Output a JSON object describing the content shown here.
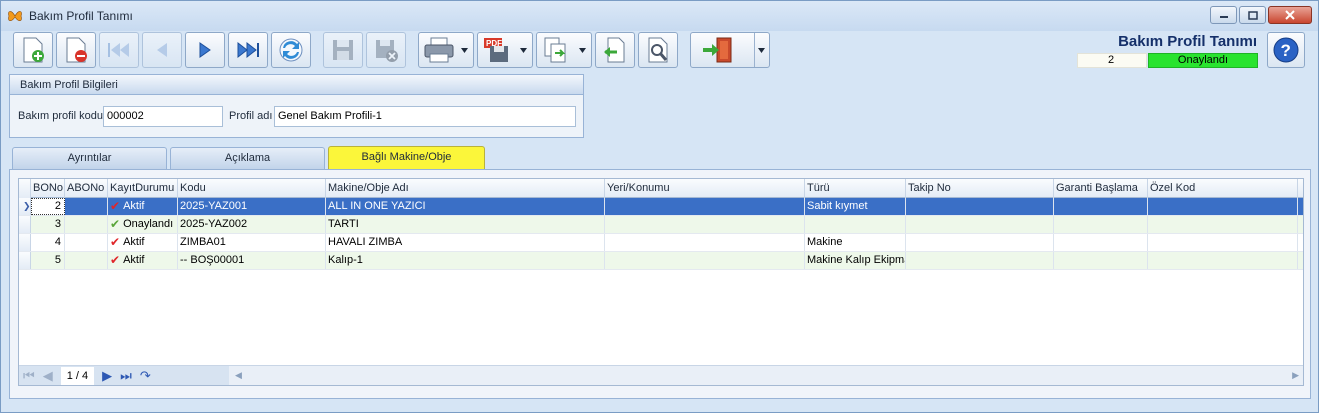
{
  "window": {
    "title": "Bakım Profil Tanımı"
  },
  "toolbar": {
    "buttons": [
      "new-icon",
      "delete-icon",
      "first-icon",
      "prev-icon",
      "next-icon",
      "last-icon",
      "refresh-icon",
      "save-icon",
      "cancel-save-icon",
      "print-icon",
      "pdf-export-icon",
      "export-icon",
      "import-icon",
      "settings-icon",
      "exit-icon"
    ]
  },
  "header": {
    "title": "Bakım Profil Tanımı",
    "record_no": "2",
    "status": "Onaylandı",
    "status_color": "#29e32f"
  },
  "profile_group": {
    "title": "Bakım Profil Bilgileri",
    "code_label": "Bakım profil kodu",
    "code_value": "000002",
    "name_label": "Profil adı",
    "name_value": "Genel Bakım Profili-1"
  },
  "tabs": [
    {
      "label": "Ayrıntılar"
    },
    {
      "label": "Açıklama"
    },
    {
      "label": "Bağlı Makine/Obje",
      "active": true
    }
  ],
  "grid": {
    "columns": [
      "BONo",
      "ABONo",
      "KayıtDurumu",
      "Kodu",
      "Makine/Obje Adı",
      "Yeri/Konumu",
      "Türü",
      "Takip No",
      "Garanti Başlama",
      "Özel Kod"
    ],
    "rows": [
      {
        "bono": "2",
        "abono": "",
        "durum": "Aktif",
        "durum_icon": "red-check-icon",
        "kodu": "2025-YAZ001",
        "adi": "ALL IN ONE YAZICI",
        "yeri": "",
        "turu": "Sabit kıymet",
        "takip": "",
        "garanti": "",
        "ozel": "",
        "selected": true
      },
      {
        "bono": "3",
        "abono": "",
        "durum": "Onaylandı",
        "durum_icon": "green-check-icon",
        "kodu": "2025-YAZ002",
        "adi": "TARTI",
        "yeri": "",
        "turu": "",
        "takip": "",
        "garanti": "",
        "ozel": ""
      },
      {
        "bono": "4",
        "abono": "",
        "durum": "Aktif",
        "durum_icon": "red-check-icon",
        "kodu": "ZIMBA01",
        "adi": "HAVALI ZIMBA",
        "yeri": "",
        "turu": "Makine",
        "takip": "",
        "garanti": "",
        "ozel": ""
      },
      {
        "bono": "5",
        "abono": "",
        "durum": "Aktif",
        "durum_icon": "red-check-icon",
        "kodu": "-- BOŞ00001",
        "adi": "Kalıp-1",
        "yeri": "",
        "turu": "Makine Kalıp Ekipmanı",
        "takip": "",
        "garanti": "",
        "ozel": ""
      }
    ]
  },
  "navigator": {
    "page": "1 / 4"
  }
}
